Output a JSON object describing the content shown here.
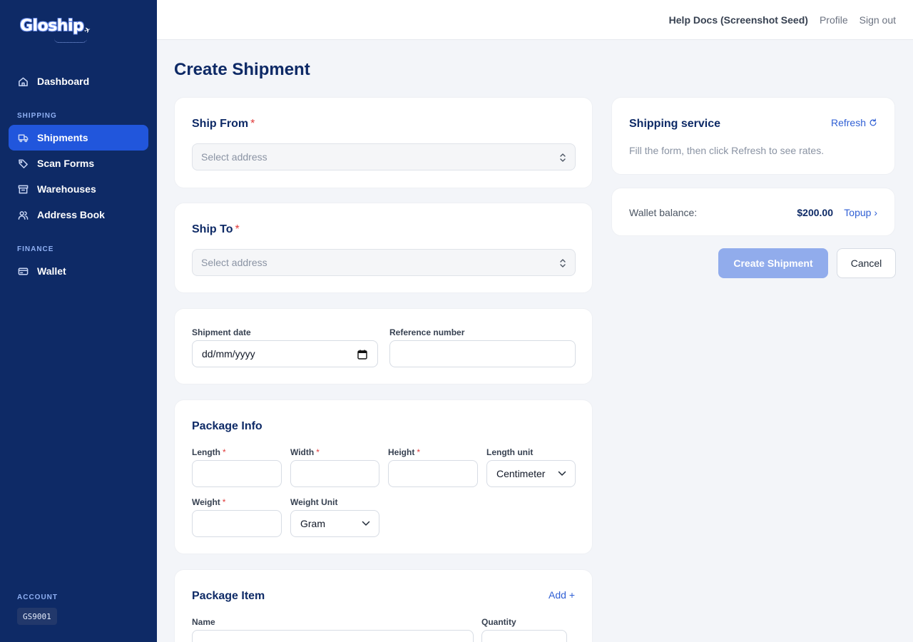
{
  "brand": {
    "name": "Gloship"
  },
  "sidebar": {
    "items": [
      {
        "label": "Dashboard",
        "icon": "home-icon"
      },
      {
        "label": "Shipments",
        "icon": "truck-icon",
        "active": true
      },
      {
        "label": "Scan Forms",
        "icon": "tag-icon"
      },
      {
        "label": "Warehouses",
        "icon": "archive-icon"
      },
      {
        "label": "Address Book",
        "icon": "users-icon"
      },
      {
        "label": "Wallet",
        "icon": "credit-card-icon"
      }
    ],
    "sections": {
      "shipping": "SHIPPING",
      "finance": "FINANCE",
      "account": "ACCOUNT"
    },
    "account_id": "GS9001"
  },
  "header": {
    "help": "Help Docs (Screenshot Seed)",
    "profile": "Profile",
    "sign_out": "Sign out"
  },
  "page": {
    "title": "Create Shipment"
  },
  "ship_from": {
    "title": "Ship From",
    "required_mark": "*",
    "placeholder": "Select address"
  },
  "ship_to": {
    "title": "Ship To",
    "required_mark": "*",
    "placeholder": "Select address"
  },
  "details": {
    "date_label": "Shipment date",
    "date_value": "dd/mm/yyyy",
    "reference_label": "Reference number",
    "reference_value": ""
  },
  "package_info": {
    "title": "Package Info",
    "length_label": "Length",
    "width_label": "Width",
    "height_label": "Height",
    "length_unit_label": "Length unit",
    "length_unit_value": "Centimeter",
    "weight_label": "Weight",
    "weight_unit_label": "Weight Unit",
    "weight_unit_value": "Gram",
    "required_mark": "*"
  },
  "package_item": {
    "title": "Package Item",
    "add_label": "Add +",
    "name_label": "Name",
    "quantity_label": "Quantity"
  },
  "shipping_service": {
    "title": "Shipping service",
    "refresh_label": "Refresh",
    "hint": "Fill the form, then click Refresh to see rates."
  },
  "wallet": {
    "label": "Wallet balance:",
    "amount": "$200.00",
    "topup_label": "Topup ›"
  },
  "actions": {
    "create_label": "Create Shipment",
    "cancel_label": "Cancel"
  },
  "colors": {
    "sidebar_bg": "#0e2a66",
    "active_nav": "#2156dc",
    "accent_link": "#2f5fd4",
    "primary_disabled": "#91acec",
    "required": "#e03a3a"
  }
}
